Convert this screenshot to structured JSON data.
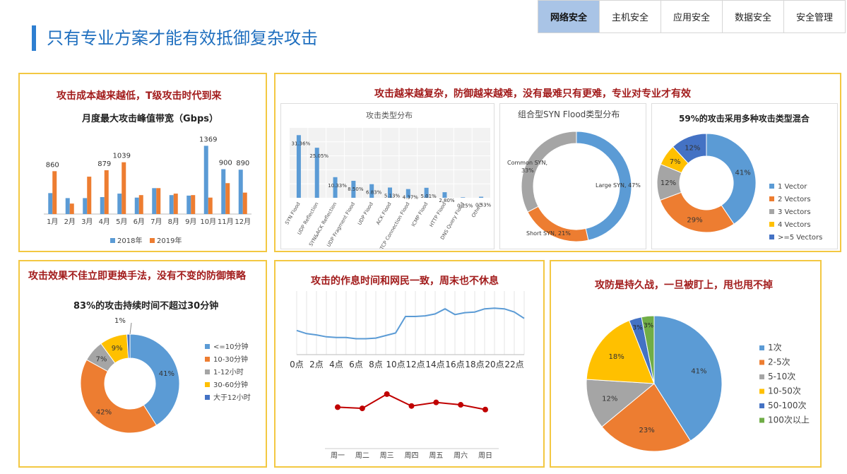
{
  "tabs": [
    "网络安全",
    "主机安全",
    "应用安全",
    "数据安全",
    "安全管理"
  ],
  "page_title": "只有专业方案才能有效抵御复杂攻击",
  "panels": {
    "p1": {
      "title": "攻击成本越来越低，T级攻击时代到来"
    },
    "p2": {
      "title": "攻击越来越复杂，防御越来越难，没有最难只有更难，专业对专业才有效"
    },
    "p3": {
      "title": "攻击效果不佳立即更换手法，没有不变的防御策略"
    },
    "p4": {
      "title": "攻击的作息时间和网民一致，周末也不休息"
    },
    "p5": {
      "title": "攻防是持久战，一旦被盯上，甩也甩不掉"
    }
  },
  "chart_data": [
    {
      "id": "monthly_peak",
      "type": "bar",
      "title": "月度最大攻击峰值带宽（Gbps）",
      "categories": [
        "1月",
        "2月",
        "3月",
        "4月",
        "5月",
        "6月",
        "7月",
        "8月",
        "9月",
        "10月",
        "11月",
        "12月"
      ],
      "series": [
        {
          "name": "2018年",
          "color": "#5b9bd5",
          "values": [
            420,
            320,
            320,
            340,
            410,
            330,
            520,
            380,
            370,
            1369,
            900,
            890
          ]
        },
        {
          "name": "2019年",
          "color": "#ed7d31",
          "values": [
            860,
            210,
            750,
            879,
            1039,
            380,
            520,
            410,
            380,
            330,
            620,
            430
          ]
        }
      ],
      "data_labels": {
        "0": "860",
        "3": "879",
        "4": "1039",
        "9": "1369",
        "10": "900",
        "11": "890"
      },
      "ylim": [
        0,
        1500
      ]
    },
    {
      "id": "attack_types",
      "type": "bar",
      "title": "攻击类型分布",
      "categories": [
        "SYN Flood",
        "UDP Reflection",
        "SYN&ACK Reflection",
        "UDP Fragment Flood",
        "UDP Flood",
        "ACK Flood",
        "TCP Connection Flood",
        "ICMP Flood",
        "HTTP Flood",
        "DNS Query Flood",
        "Others"
      ],
      "values": [
        31.36,
        25.05,
        10.33,
        8.5,
        6.83,
        5.13,
        4.37,
        5.01,
        2.8,
        0.25,
        0.53
      ],
      "value_labels": [
        "31.36%",
        "25.05%",
        "10.33%",
        "8.50%",
        "6.83%",
        "5.13%",
        "4.37%",
        "5.01%",
        "2.80%",
        "0.25%",
        "0.53%"
      ],
      "color": "#5b9bd5",
      "ylim": [
        0,
        35
      ]
    },
    {
      "id": "syn_flood",
      "type": "pie",
      "title": "组合型SYN Flood类型分布",
      "slices": [
        {
          "label": "Large SYN, 47%",
          "value": 47,
          "color": "#5b9bd5"
        },
        {
          "label": "Short SYN, 21%",
          "value": 21,
          "color": "#ed7d31"
        },
        {
          "label": "Common SYN, 33%",
          "value": 33,
          "color": "#a5a5a5"
        }
      ]
    },
    {
      "id": "vectors",
      "type": "pie",
      "title": "59%的攻击采用多种攻击类型混合",
      "slices": [
        {
          "name": "1 Vector",
          "label": "41%",
          "value": 41,
          "color": "#5b9bd5"
        },
        {
          "name": "2 Vectors",
          "label": "29%",
          "value": 29,
          "color": "#ed7d31"
        },
        {
          "name": "3 Vectors",
          "label": "12%",
          "value": 12,
          "color": "#a5a5a5"
        },
        {
          "name": "4 Vectors",
          "label": "7%",
          "value": 7,
          "color": "#ffc000"
        },
        {
          "name": ">=5 Vectors",
          "label": "12%",
          "value": 12,
          "color": "#4472c4"
        }
      ]
    },
    {
      "id": "duration",
      "type": "pie",
      "title": "83%的攻击持续时间不超过30分钟",
      "slices": [
        {
          "name": "<=10分钟",
          "label": "41%",
          "value": 41,
          "color": "#5b9bd5"
        },
        {
          "name": "10-30分钟",
          "label": "42%",
          "value": 42,
          "color": "#ed7d31"
        },
        {
          "name": "1-12小时",
          "label": "7%",
          "value": 7,
          "color": "#a5a5a5"
        },
        {
          "name": "30-60分钟",
          "label": "9%",
          "value": 9,
          "color": "#ffc000"
        },
        {
          "name": "大于12小时",
          "label": "1%",
          "value": 1,
          "color": "#4472c4"
        }
      ]
    },
    {
      "id": "hourly",
      "type": "area",
      "categories": [
        "0点",
        "2点",
        "4点",
        "6点",
        "8点",
        "10点",
        "12点",
        "14点",
        "16点",
        "18点",
        "20点",
        "22点"
      ],
      "x": [
        0,
        1,
        2,
        3,
        4,
        5,
        6,
        7,
        8,
        9,
        10,
        11,
        12,
        13,
        14,
        15,
        16,
        17,
        18,
        19,
        20,
        21,
        22,
        23
      ],
      "values": [
        38,
        33,
        31,
        28,
        27,
        27,
        25,
        25,
        26,
        30,
        34,
        60,
        60,
        61,
        64,
        72,
        63,
        66,
        67,
        72,
        73,
        72,
        67,
        57
      ],
      "color": "#5b9bd5",
      "ylim": [
        0,
        100
      ]
    },
    {
      "id": "weekly",
      "type": "line",
      "categories": [
        "周一",
        "周二",
        "周三",
        "周四",
        "周五",
        "周六",
        "周日"
      ],
      "values": [
        40,
        38,
        62,
        42,
        48,
        44,
        36
      ],
      "color": "#c00000",
      "ylim": [
        0,
        100
      ]
    },
    {
      "id": "persistence",
      "type": "pie",
      "slices": [
        {
          "name": "1次",
          "label": "41%",
          "value": 41,
          "color": "#5b9bd5"
        },
        {
          "name": "2-5次",
          "label": "23%",
          "value": 23,
          "color": "#ed7d31"
        },
        {
          "name": "5-10次",
          "label": "12%",
          "value": 12,
          "color": "#a5a5a5"
        },
        {
          "name": "10-50次",
          "label": "18%",
          "value": 18,
          "color": "#ffc000"
        },
        {
          "name": "50-100次",
          "label": "3%",
          "value": 3,
          "color": "#4472c4"
        },
        {
          "name": "100次以上",
          "label": "3%",
          "value": 3,
          "color": "#70ad47"
        }
      ]
    }
  ]
}
